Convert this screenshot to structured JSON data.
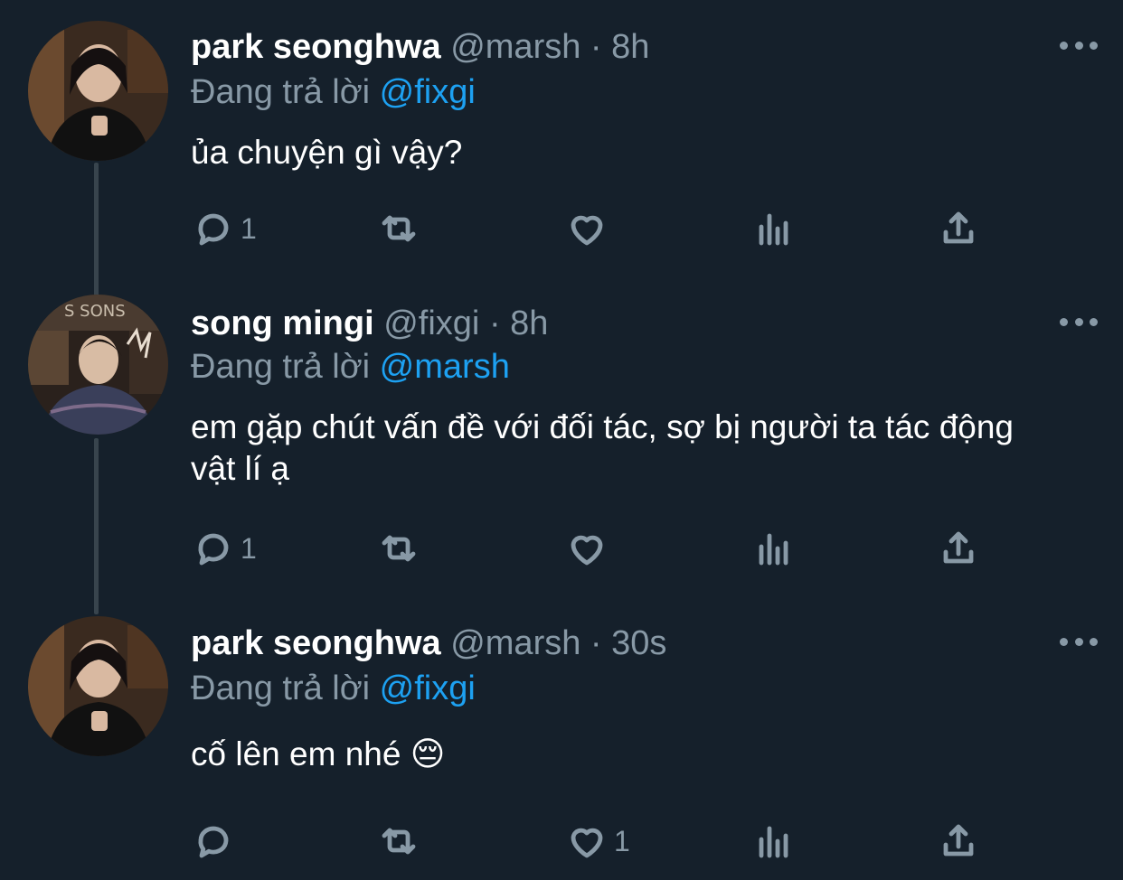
{
  "colors": {
    "background": "#15202b",
    "muted": "#8899a6",
    "mention": "#1da1f2",
    "thread_line": "#38444d"
  },
  "tweets": [
    {
      "name": "park seonghwa",
      "handle": "@marsh",
      "separator": "·",
      "time": "8h",
      "replying_prefix": "Đang trả lời",
      "replying_to": "@fixgi",
      "text": "ủa chuyện gì vậy?",
      "reply_count": "1",
      "retweet_count": "",
      "like_count": ""
    },
    {
      "name": "song mingi",
      "handle": "@fixgi",
      "separator": "·",
      "time": "8h",
      "replying_prefix": "Đang trả lời",
      "replying_to": "@marsh",
      "text": "em gặp chút vấn đề với đối tác, sợ bị người ta tác động vật lí ạ",
      "reply_count": "1",
      "retweet_count": "",
      "like_count": ""
    },
    {
      "name": "park seonghwa",
      "handle": "@marsh",
      "separator": "·",
      "time": "30s",
      "replying_prefix": "Đang trả lời",
      "replying_to": "@fixgi",
      "text": "cố lên em nhé 😔",
      "reply_count": "",
      "retweet_count": "",
      "like_count": "1"
    }
  ],
  "icons": {
    "reply": "reply-icon",
    "retweet": "retweet-icon",
    "like": "heart-icon",
    "analytics": "analytics-icon",
    "share": "share-icon",
    "more": "more-icon"
  }
}
